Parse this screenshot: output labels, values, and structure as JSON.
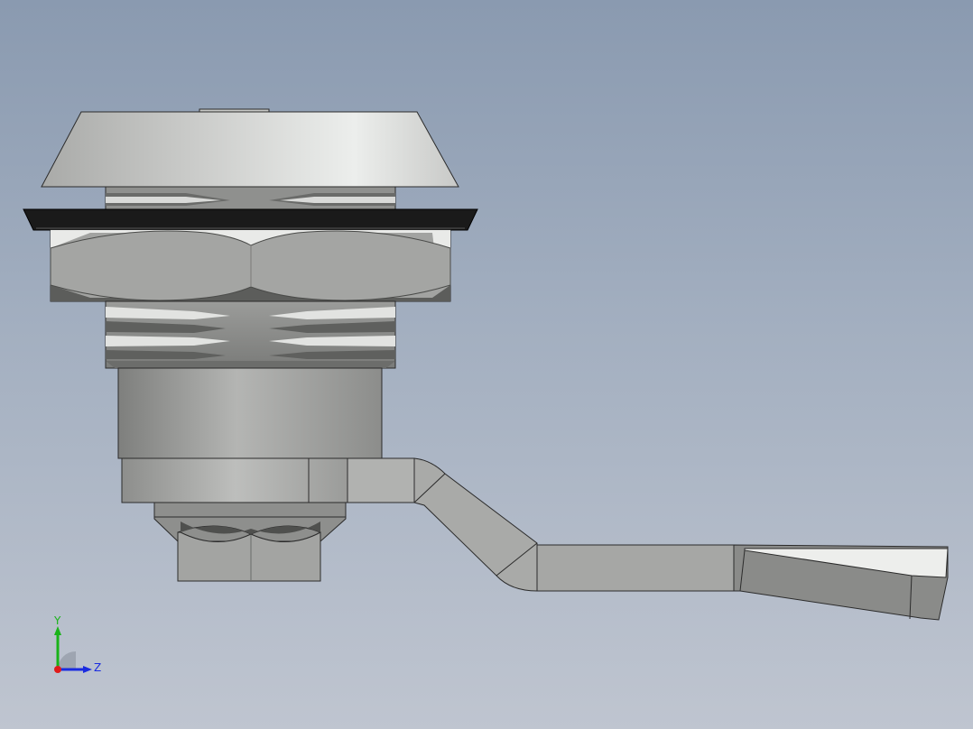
{
  "viewport": {
    "background_top": "#8a9ab0",
    "background_bottom": "#bfc5d0"
  },
  "model": {
    "name": "cam-lock-assembly",
    "parts": [
      "cap-head",
      "gasket",
      "hex-nut",
      "threaded-body",
      "barrel",
      "cam-hub",
      "retaining-nut",
      "cam-lever"
    ]
  },
  "triad": {
    "y_label": "Y",
    "z_label": "Z",
    "y_color": "#19b319",
    "z_color": "#1a2be0",
    "x_color": "#e01a1a"
  }
}
